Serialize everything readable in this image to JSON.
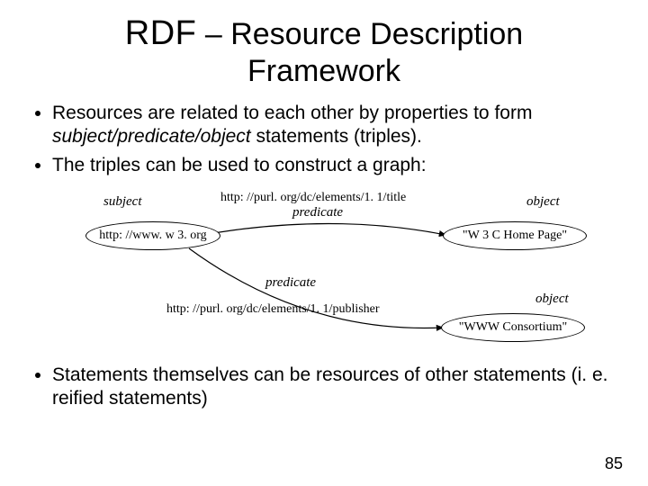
{
  "title_line1_prefix": "RDF",
  "title_line1_rest": " – Resource Description",
  "title_line2": "Framework",
  "bullets_top": [
    {
      "pre": "Resources are related to each other by properties to form ",
      "italic": "subject/predicate/object",
      "post": " statements (triples)."
    },
    {
      "pre": "The triples can be used to construct a graph:",
      "italic": "",
      "post": ""
    }
  ],
  "diagram": {
    "subject_label": "subject",
    "subject_node": "http: //www. w 3. org",
    "pred1_url": "http: //purl. org/dc/elements/1. 1/title",
    "pred1_label": "predicate",
    "object1_label": "object",
    "object1_node": "\"W 3 C Home Page\"",
    "pred2_label": "predicate",
    "pred2_url": "http: //purl. org/dc/elements/1. 1/publisher",
    "object2_label": "object",
    "object2_node": "\"WWW Consortium\""
  },
  "bullets_bottom": [
    "Statements themselves can be resources of other statements (i. e. reified statements)"
  ],
  "page_number": "85"
}
